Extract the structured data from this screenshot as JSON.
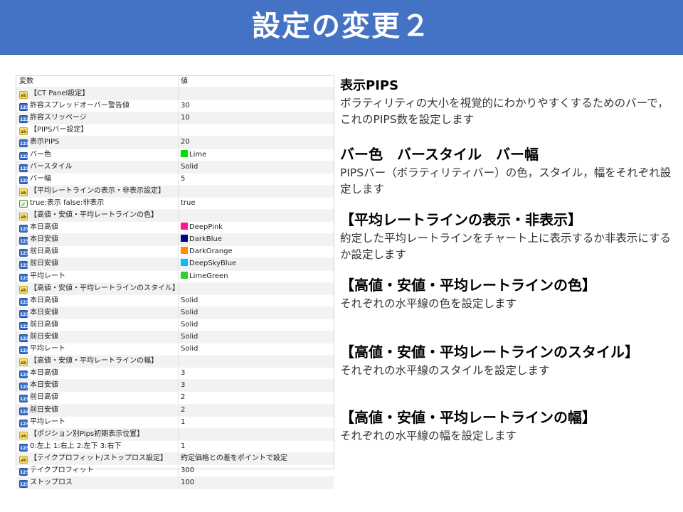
{
  "banner": {
    "title": "設定の変更２"
  },
  "table": {
    "header": {
      "name": "変数",
      "value": "値"
    },
    "rows": [
      {
        "icon": "ab",
        "name": "【CT Panel設定】",
        "value": ""
      },
      {
        "icon": "123",
        "name": "許容スプレッドオーバー警告値",
        "value": "30"
      },
      {
        "icon": "123",
        "name": "許容スリッページ",
        "value": "10"
      },
      {
        "icon": "ab",
        "name": "【PIPSバー設定】",
        "value": ""
      },
      {
        "icon": "123",
        "name": "表示PIPS",
        "value": "20"
      },
      {
        "icon": "123",
        "name": "バー色",
        "value": "Lime",
        "color": "#00dd00"
      },
      {
        "icon": "123",
        "name": "バースタイル",
        "value": "Solid"
      },
      {
        "icon": "123",
        "name": "バー幅",
        "value": "5"
      },
      {
        "icon": "ab",
        "name": "【平均レートラインの表示・非表示設定】",
        "value": ""
      },
      {
        "icon": "bool",
        "name": "true:表示 false:非表示",
        "value": "true"
      },
      {
        "icon": "ab",
        "name": "【高値・安値・平均レートラインの色】",
        "value": ""
      },
      {
        "icon": "123",
        "name": "本日高値",
        "value": "DeepPink",
        "color": "#ff1493"
      },
      {
        "icon": "123",
        "name": "本日安値",
        "value": "DarkBlue",
        "color": "#00008b"
      },
      {
        "icon": "123",
        "name": "前日高値",
        "value": "DarkOrange",
        "color": "#ff8c00"
      },
      {
        "icon": "123",
        "name": "前日安値",
        "value": "DeepSkyBlue",
        "color": "#00bfff"
      },
      {
        "icon": "123",
        "name": "平均レート",
        "value": "LimeGreen",
        "color": "#32cd32"
      },
      {
        "icon": "ab",
        "name": "【高値・安値・平均レートラインのスタイル】",
        "value": ""
      },
      {
        "icon": "123",
        "name": "本日高値",
        "value": "Solid"
      },
      {
        "icon": "123",
        "name": "本日安値",
        "value": "Solid"
      },
      {
        "icon": "123",
        "name": "前日高値",
        "value": "Solid"
      },
      {
        "icon": "123",
        "name": "前日安値",
        "value": "Solid"
      },
      {
        "icon": "123",
        "name": "平均レート",
        "value": "Solid"
      },
      {
        "icon": "ab",
        "name": "【高値・安値・平均レートラインの幅】",
        "value": ""
      },
      {
        "icon": "123",
        "name": "本日高値",
        "value": "3"
      },
      {
        "icon": "123",
        "name": "本日安値",
        "value": "3"
      },
      {
        "icon": "123",
        "name": "前日高値",
        "value": "2"
      },
      {
        "icon": "123",
        "name": "前日安値",
        "value": "2"
      },
      {
        "icon": "123",
        "name": "平均レート",
        "value": "1"
      },
      {
        "icon": "ab",
        "name": "【ポジション別Pips初期表示位置】",
        "value": ""
      },
      {
        "icon": "123",
        "name": "0:左上 1:右上 2:左下 3:右下",
        "value": "1"
      },
      {
        "icon": "ab",
        "name": "【テイクプロフィット/ストップロス設定】",
        "value": "約定価格との差をポイントで設定"
      },
      {
        "icon": "123",
        "name": "テイクプロフィット",
        "value": "300"
      },
      {
        "icon": "123",
        "name": "ストップロス",
        "value": "100"
      }
    ]
  },
  "sections": [
    {
      "title": "表示PIPS",
      "body": "ボラティリティの大小を視覚的にわかりやすくするためのバーで，これのPIPS数を設定します"
    },
    {
      "title": "バー色　バースタイル　バー幅",
      "body": "PIPSバー（ボラティリティバー）の色，スタイル，幅をそれぞれ設定します"
    },
    {
      "title": "【平均レートラインの表示・非表示】",
      "body": "約定した平均レートラインをチャート上に表示するか非表示にするか設定します"
    },
    {
      "title": "【高値・安値・平均レートラインの色】",
      "body": "それぞれの水平線の色を設定します"
    },
    {
      "title": "【高値・安値・平均レートラインのスタイル】",
      "body": "それぞれの水平線のスタイルを設定します"
    },
    {
      "title": "【高値・安値・平均レートラインの幅】",
      "body": "それぞれの水平線の幅を設定します"
    }
  ]
}
